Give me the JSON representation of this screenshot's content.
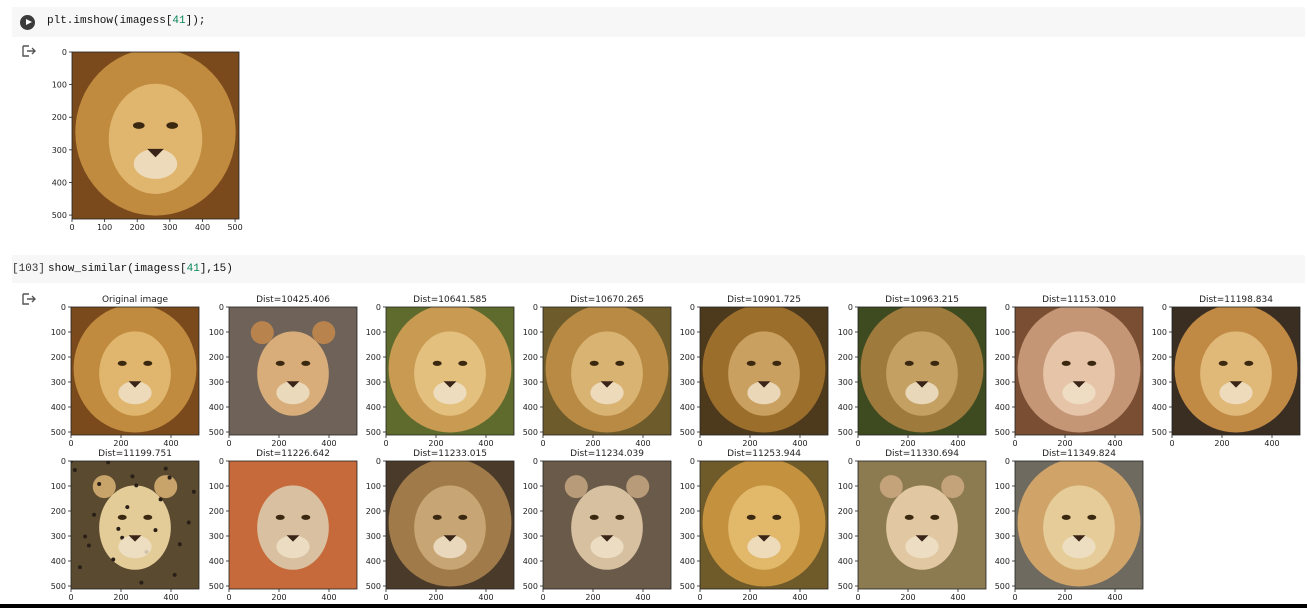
{
  "cell1": {
    "code_prefix": "plt.imshow(imagess[",
    "code_num": "41",
    "code_suffix": "]);"
  },
  "cell2": {
    "exec_count": "[103]",
    "code_prefix": "show_similar(imagess[",
    "code_num": "41",
    "code_suffix": "],15)"
  },
  "icons": {
    "run": "play-circle-icon",
    "output": "output-arrow-icon"
  },
  "colors": {
    "cell_bg": "#f7f7f7",
    "number": "#098658"
  },
  "single_plot": {
    "xticks": [
      "0",
      "100",
      "200",
      "300",
      "400",
      "500"
    ],
    "yticks": [
      "0",
      "100",
      "200",
      "300",
      "400",
      "500"
    ],
    "image": "lion-face"
  },
  "grid_plot": {
    "xticks": [
      "0",
      "200",
      "400"
    ],
    "yticks": [
      "0",
      "100",
      "200",
      "300",
      "400",
      "500"
    ],
    "panels": [
      {
        "title": "Original image",
        "subject": "lion",
        "palette": [
          "#c08b3e",
          "#7a4a1c",
          "#e0b66e"
        ]
      },
      {
        "title": "Dist=10425.406",
        "subject": "lioness",
        "palette": [
          "#b9834d",
          "#6f6258",
          "#d8ad7a"
        ]
      },
      {
        "title": "Dist=10641.585",
        "subject": "lion",
        "palette": [
          "#c99a52",
          "#5e6b2c",
          "#e4c07e"
        ]
      },
      {
        "title": "Dist=10670.265",
        "subject": "lion",
        "palette": [
          "#b88a43",
          "#6d5b2c",
          "#d9b372"
        ]
      },
      {
        "title": "Dist=10901.725",
        "subject": "lion",
        "palette": [
          "#9c6e2b",
          "#4d3a1c",
          "#caa060"
        ]
      },
      {
        "title": "Dist=10963.215",
        "subject": "lion",
        "palette": [
          "#9f7a3d",
          "#3e4a1f",
          "#c4a063"
        ]
      },
      {
        "title": "Dist=11153.010",
        "subject": "lion",
        "palette": [
          "#c49676",
          "#7a4e33",
          "#e6c4a8"
        ]
      },
      {
        "title": "Dist=11198.834",
        "subject": "lion",
        "palette": [
          "#c08a45",
          "#3a2e22",
          "#e0b878"
        ]
      },
      {
        "title": "Dist=11199.751",
        "subject": "cheetah",
        "palette": [
          "#c9a46a",
          "#5a4a30",
          "#e4cc98"
        ]
      },
      {
        "title": "Dist=11226.642",
        "subject": "coyote",
        "palette": [
          "#b98b5e",
          "#c76a3b",
          "#d8c0a0"
        ]
      },
      {
        "title": "Dist=11233.015",
        "subject": "lion",
        "palette": [
          "#a07a48",
          "#4a3a2a",
          "#c8a574"
        ]
      },
      {
        "title": "Dist=11234.039",
        "subject": "lioness",
        "palette": [
          "#b89b78",
          "#6a5a4a",
          "#d6c0a0"
        ]
      },
      {
        "title": "Dist=11253.944",
        "subject": "lion",
        "palette": [
          "#c4923f",
          "#6f5a2a",
          "#e2b86a"
        ]
      },
      {
        "title": "Dist=11330.694",
        "subject": "lioness",
        "palette": [
          "#c4a27a",
          "#8c7a50",
          "#e2c8a2"
        ]
      },
      {
        "title": "Dist=11349.824",
        "subject": "lion",
        "palette": [
          "#d0a468",
          "#6e6a60",
          "#e6cc98"
        ]
      }
    ]
  }
}
